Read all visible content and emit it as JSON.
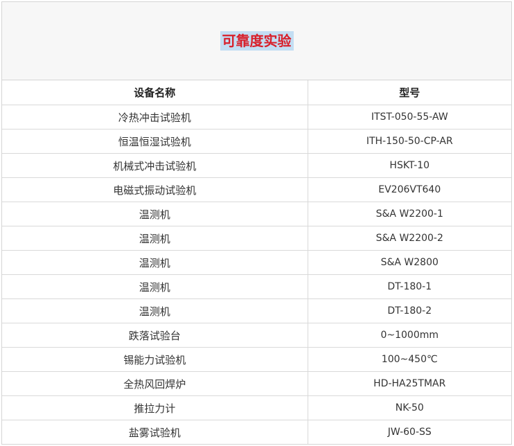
{
  "title": "可靠度实验",
  "header": {
    "name": "设备名称",
    "model": "型号"
  },
  "rows": [
    {
      "name": "冷热冲击试验机",
      "model": "ITST-050-55-AW"
    },
    {
      "name": "恒温恒湿试验机",
      "model": "ITH-150-50-CP-AR"
    },
    {
      "name": "机械式冲击试验机",
      "model": "HSKT-10"
    },
    {
      "name": "电磁式振动试验机",
      "model": "EV206VT640"
    },
    {
      "name": "温测机",
      "model": "S&A W2200-1"
    },
    {
      "name": "温测机",
      "model": "S&A W2200-2"
    },
    {
      "name": "温测机",
      "model": "S&A W2800"
    },
    {
      "name": "温测机",
      "model": "DT-180-1"
    },
    {
      "name": "温测机",
      "model": "DT-180-2"
    },
    {
      "name": "跌落试验台",
      "model": "0~1000mm"
    },
    {
      "name": "锡能力试验机",
      "model": "100~450℃"
    },
    {
      "name": "全热风回焊炉",
      "model": "HD-HA25TMAR"
    },
    {
      "name": "推拉力计",
      "model": "NK-50"
    },
    {
      "name": "盐雾试验机",
      "model": "JW-60-SS"
    }
  ]
}
